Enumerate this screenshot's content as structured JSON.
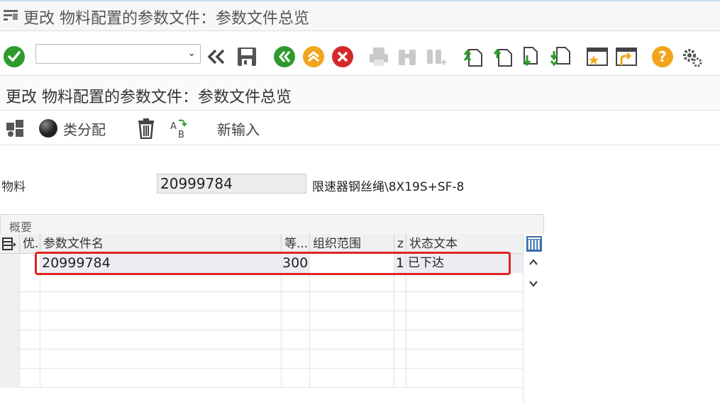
{
  "window": {
    "title": "更改 物料配置的参数文件：参数文件总览"
  },
  "toolbar": {
    "command_value": "",
    "icons": [
      "enter-icon",
      "command-dropdown",
      "back-double-icon",
      "save-icon",
      "back-icon",
      "exit-icon",
      "cancel-icon",
      "print-icon",
      "find-icon",
      "find-next-icon",
      "first-page-icon",
      "previous-page-icon",
      "next-page-icon",
      "last-page-icon",
      "create-session-icon",
      "shortcut-icon",
      "help-icon",
      "settings-icon"
    ]
  },
  "subheader": {
    "title": "更改 物料配置的参数文件：参数文件总览"
  },
  "app_toolbar": {
    "class_assign_label": "类分配",
    "new_entry_label": "新输入"
  },
  "material": {
    "label": "物料",
    "value": "20999784",
    "description": "限速器钢丝绳\\8X19S+SF-8"
  },
  "overview": {
    "caption": "概要",
    "columns": [
      "优.",
      "参数文件名",
      "等...",
      "组织范围",
      "z",
      "状态文本"
    ],
    "rows": [
      {
        "priority": "",
        "profile_name": "20999784",
        "level": "300",
        "org_area": "",
        "status_num": "1",
        "status_text": "已下达"
      }
    ]
  },
  "colors": {
    "accent_green": "#2e9a2e",
    "accent_orange": "#f2a51c",
    "accent_red": "#d62828",
    "highlight": "#e32222"
  }
}
